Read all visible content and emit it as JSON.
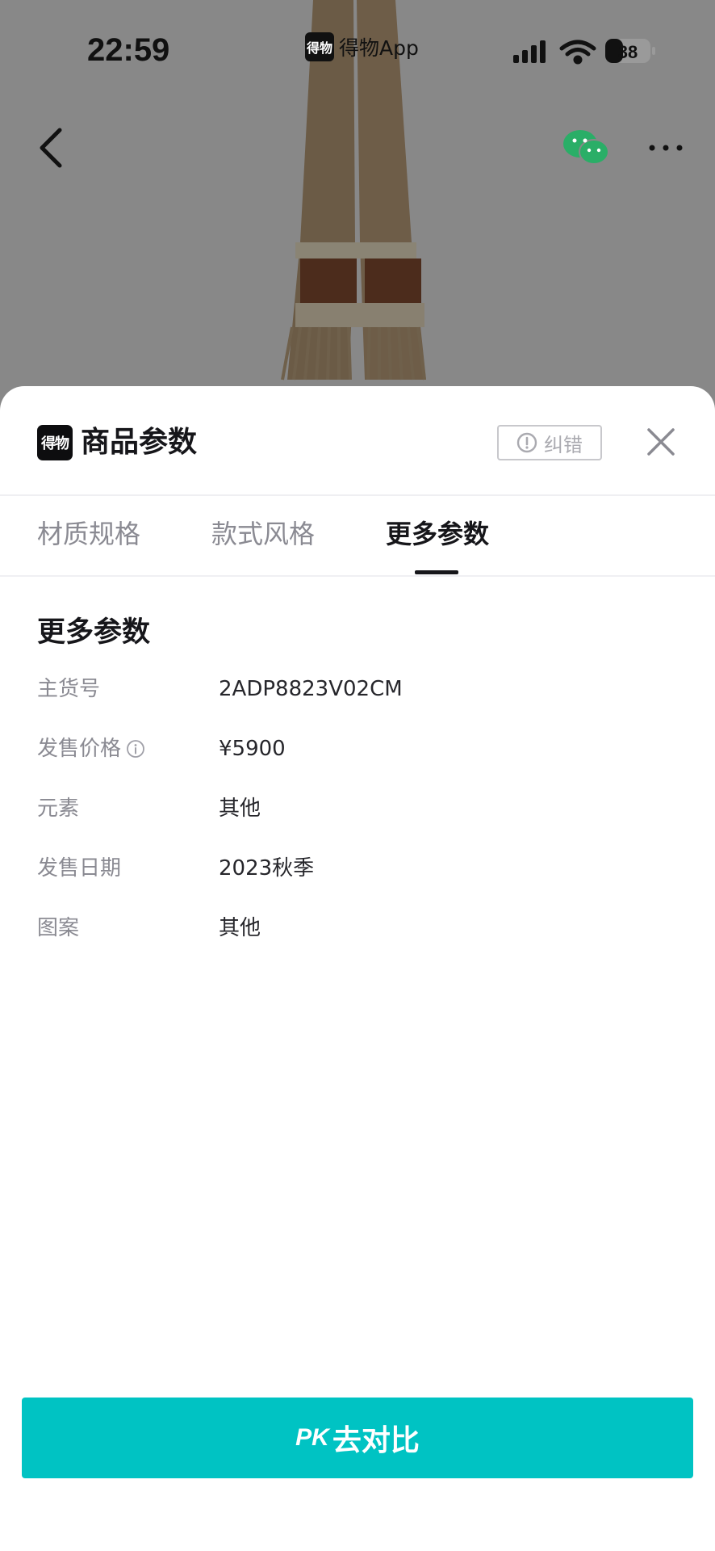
{
  "status_bar": {
    "time": "22:59",
    "app_logo_text": "得物",
    "app_name": "得物App",
    "battery": "38"
  },
  "nav": {
    "back_icon": "chevron-left-icon",
    "share_icon": "wechat-icon",
    "more_icon": "more-dots-icon"
  },
  "sheet": {
    "logo_text": "得物",
    "title": "商品参数",
    "report_label": "纠错",
    "close_icon": "close-icon"
  },
  "tabs": [
    {
      "label": "材质规格",
      "active": false
    },
    {
      "label": "款式风格",
      "active": false
    },
    {
      "label": "更多参数",
      "active": true
    }
  ],
  "section": {
    "title": "更多参数",
    "rows": [
      {
        "label": "主货号",
        "value": "2ADP8823V02CM"
      },
      {
        "label": "发售价格",
        "value": "¥5900",
        "info_icon": true
      },
      {
        "label": "元素",
        "value": "其他"
      },
      {
        "label": "发售日期",
        "value": "2023秋季"
      },
      {
        "label": "图案",
        "value": "其他"
      }
    ]
  },
  "pk_button": {
    "mark": "PK",
    "label": "去对比"
  },
  "colors": {
    "accent": "#00c3c3",
    "wechat_green": "#2aae67",
    "overlay": "#888888"
  }
}
